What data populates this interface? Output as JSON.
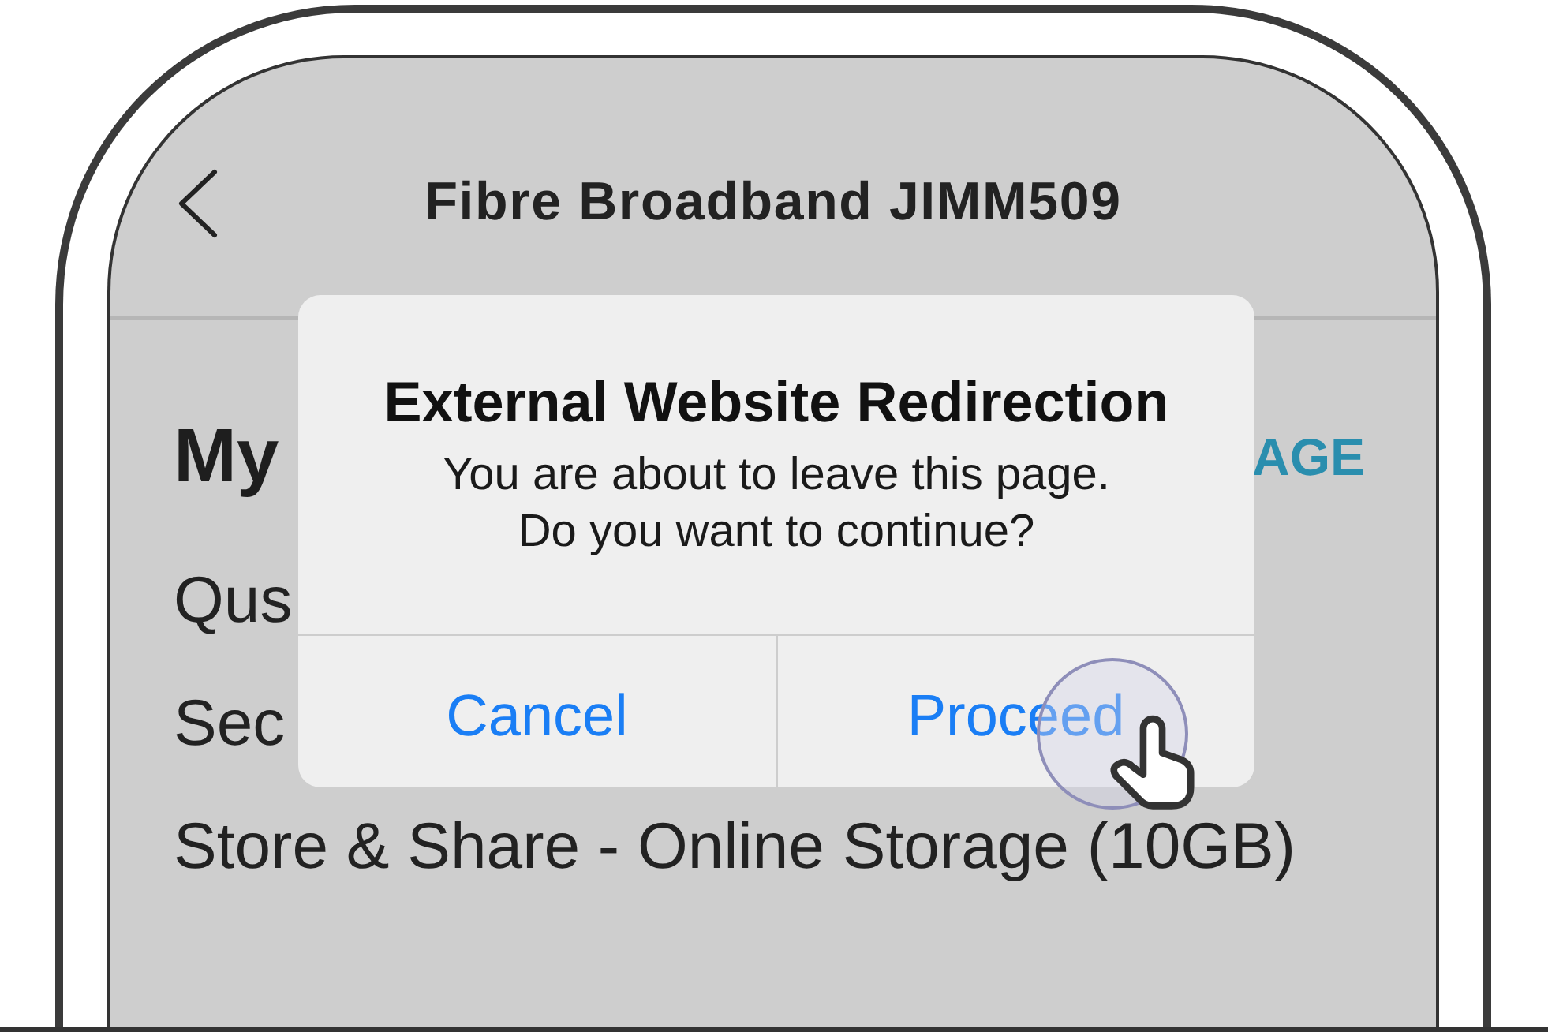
{
  "screen": {
    "title": "Fibre Broadband JIMM509",
    "section": {
      "heading": "My",
      "link": "AGE"
    },
    "items": [
      "Qus",
      "Sec",
      "Store & Share - Online Storage (10GB)"
    ]
  },
  "dialog": {
    "title": "External Website Redirection",
    "message": "You are about to leave this page.\nDo you want to continue?",
    "buttons": [
      "Cancel",
      "Proceed"
    ]
  }
}
